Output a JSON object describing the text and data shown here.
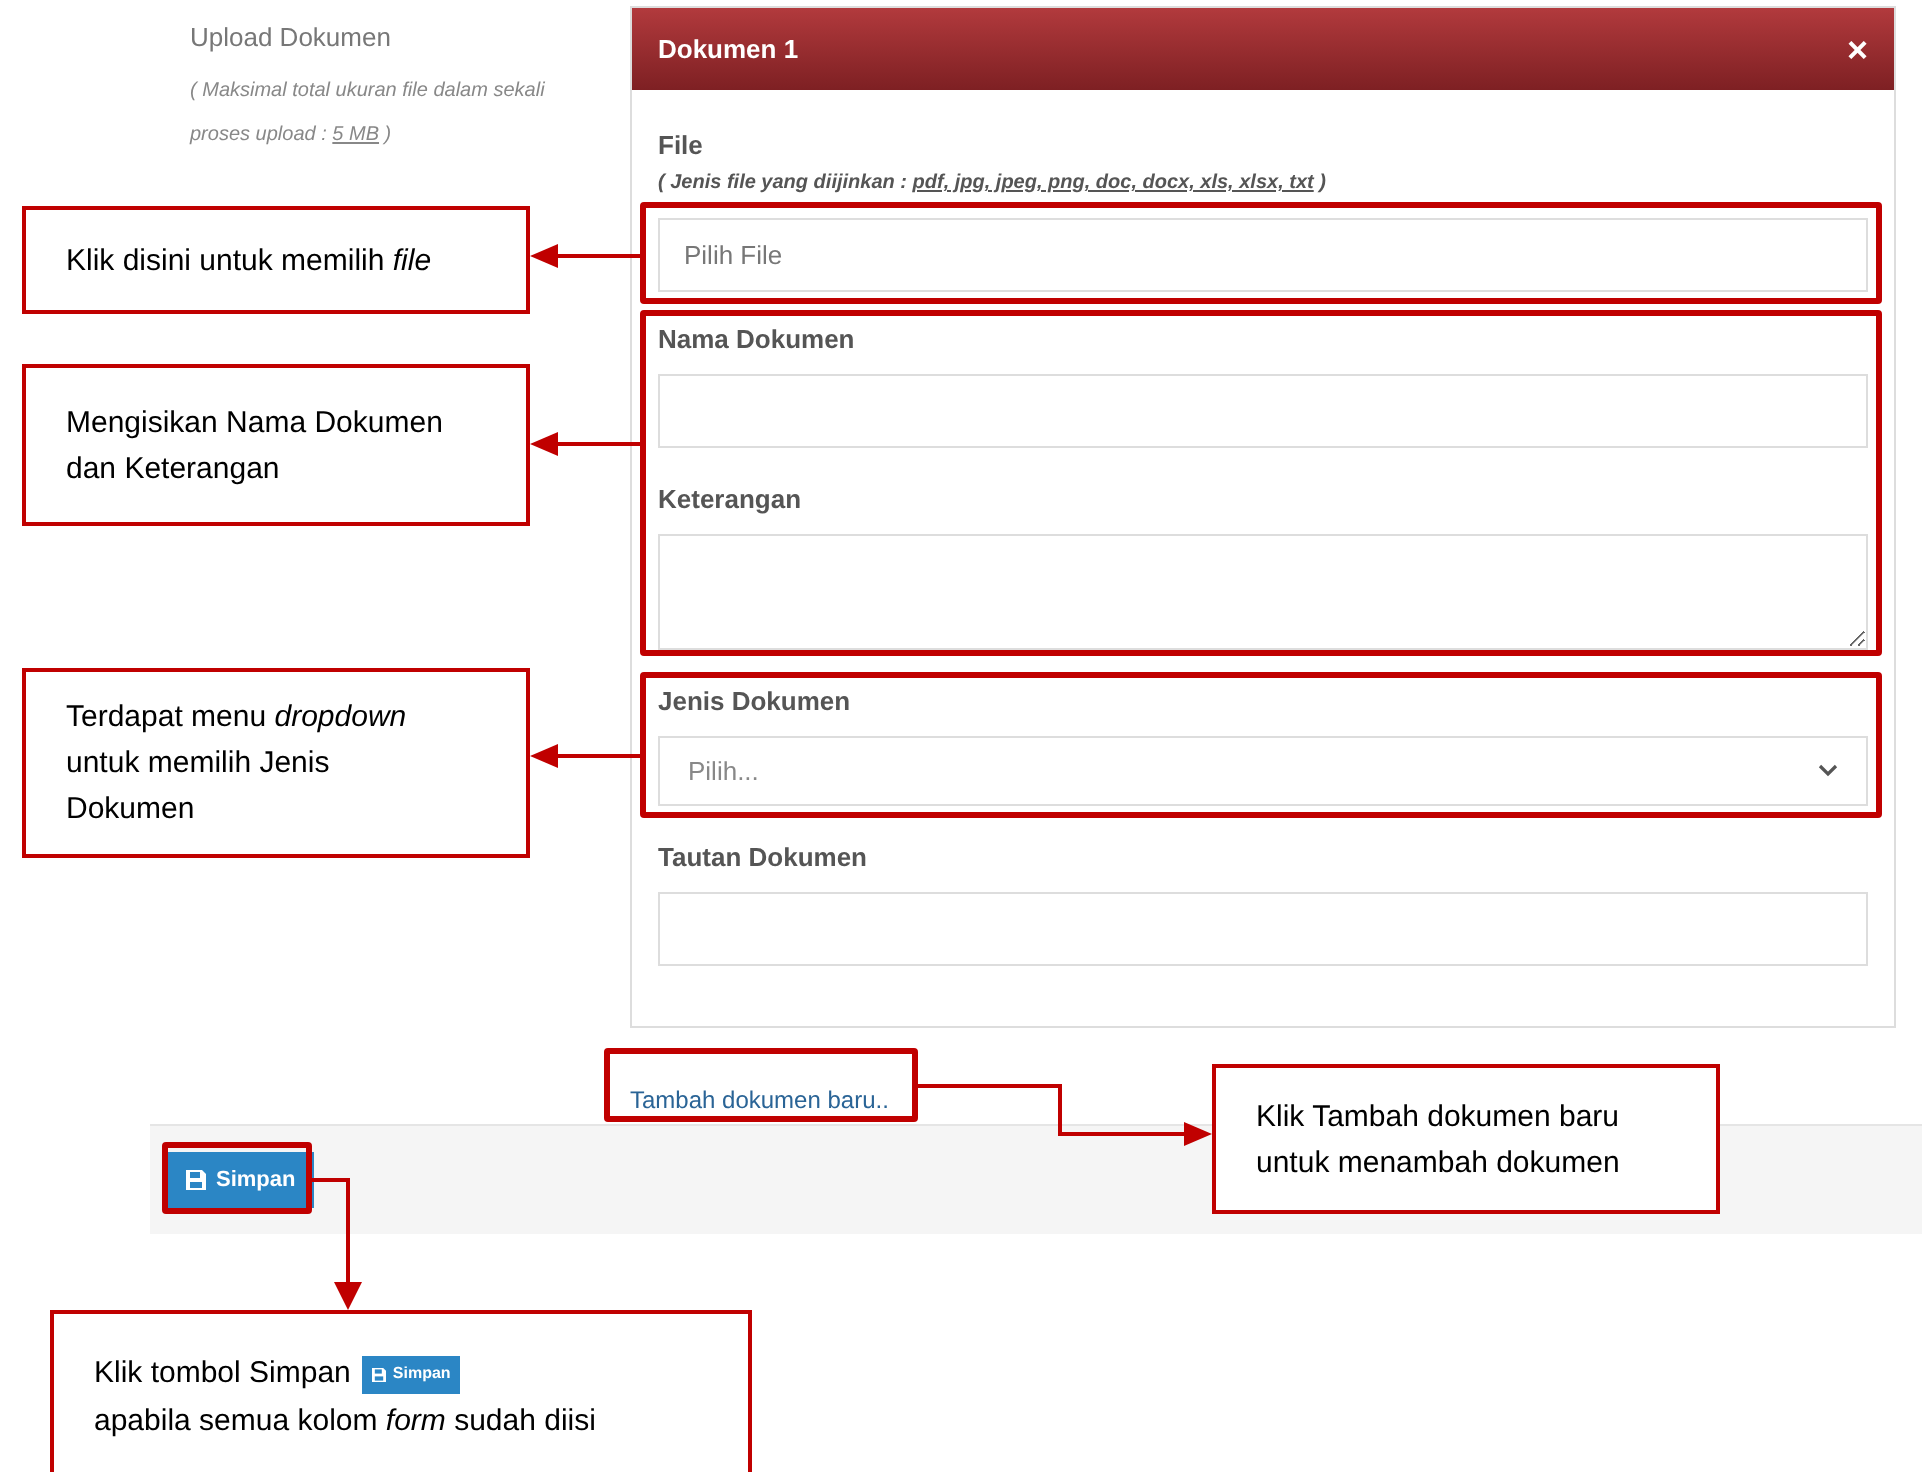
{
  "upload": {
    "title": "Upload Dokumen",
    "note": "( Maksimal total ukuran file dalam sekali proses upload : ",
    "limit": "5 MB",
    "note_end": " )"
  },
  "panel": {
    "title": "Dokumen 1",
    "close": "×",
    "fields": [
      {
        "kind": "file",
        "label": "File",
        "hint": "( Jenis file yang diijinkan : ",
        "hint_types": "pdf, jpg, jpeg, png, doc, docx, xls, xlsx, txt",
        "hint_end": " )",
        "placeholder": "Pilih File"
      },
      {
        "kind": "text",
        "label": "Nama Dokumen"
      },
      {
        "kind": "textarea",
        "label": "Keterangan"
      },
      {
        "kind": "select",
        "label": "Jenis Dokumen",
        "value": "Pilih..."
      },
      {
        "kind": "text",
        "label": "Tautan Dokumen"
      }
    ]
  },
  "add_link": "Tambah dokumen baru..",
  "save_button": "Simpan",
  "callouts": [
    {
      "text": "Klik disini untuk memilih *file*"
    },
    {
      "text": "Mengisikan Nama Dokumen dan Keterangan"
    },
    {
      "text": "Terdapat menu *dropdown* untuk memilih Jenis Dokumen"
    },
    {
      "text": "Klik Tambah dokumen baru untuk menambah dokumen"
    },
    {
      "text": "Klik tombol Simpan",
      "button": "Simpan",
      "text_end": "apabila semua kolom *form* sudah diisi"
    }
  ]
}
